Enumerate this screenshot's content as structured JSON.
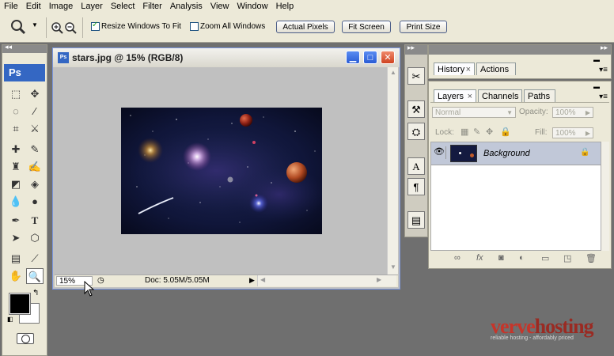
{
  "menu": [
    "File",
    "Edit",
    "Image",
    "Layer",
    "Select",
    "Filter",
    "Analysis",
    "View",
    "Window",
    "Help"
  ],
  "options": {
    "resize_label": "Resize Windows To Fit",
    "resize_checked": true,
    "zoom_all_label": "Zoom All Windows",
    "zoom_all_checked": false,
    "actual_pixels": "Actual Pixels",
    "fit_screen": "Fit Screen",
    "print_size": "Print Size"
  },
  "toolbox": {
    "logo": "Ps"
  },
  "document": {
    "title": "stars.jpg @ 15% (RGB/8)",
    "zoom": "15%",
    "doc_info": "Doc: 5.05M/5.05M"
  },
  "history_panel": {
    "tabs": [
      "History",
      "Actions"
    ]
  },
  "layers_panel": {
    "tabs": [
      "Layers",
      "Channels",
      "Paths"
    ],
    "blend_mode": "Normal",
    "opacity_label": "Opacity:",
    "opacity_value": "100%",
    "lock_label": "Lock:",
    "fill_label": "Fill:",
    "fill_value": "100%",
    "layer_name": "Background"
  },
  "watermark": {
    "brand_a": "verve",
    "brand_b": "hosting",
    "tagline": "reliable hosting - affordably priced"
  },
  "colors": {
    "accent": "#3467c3",
    "watermark_red": "#c6352a"
  }
}
